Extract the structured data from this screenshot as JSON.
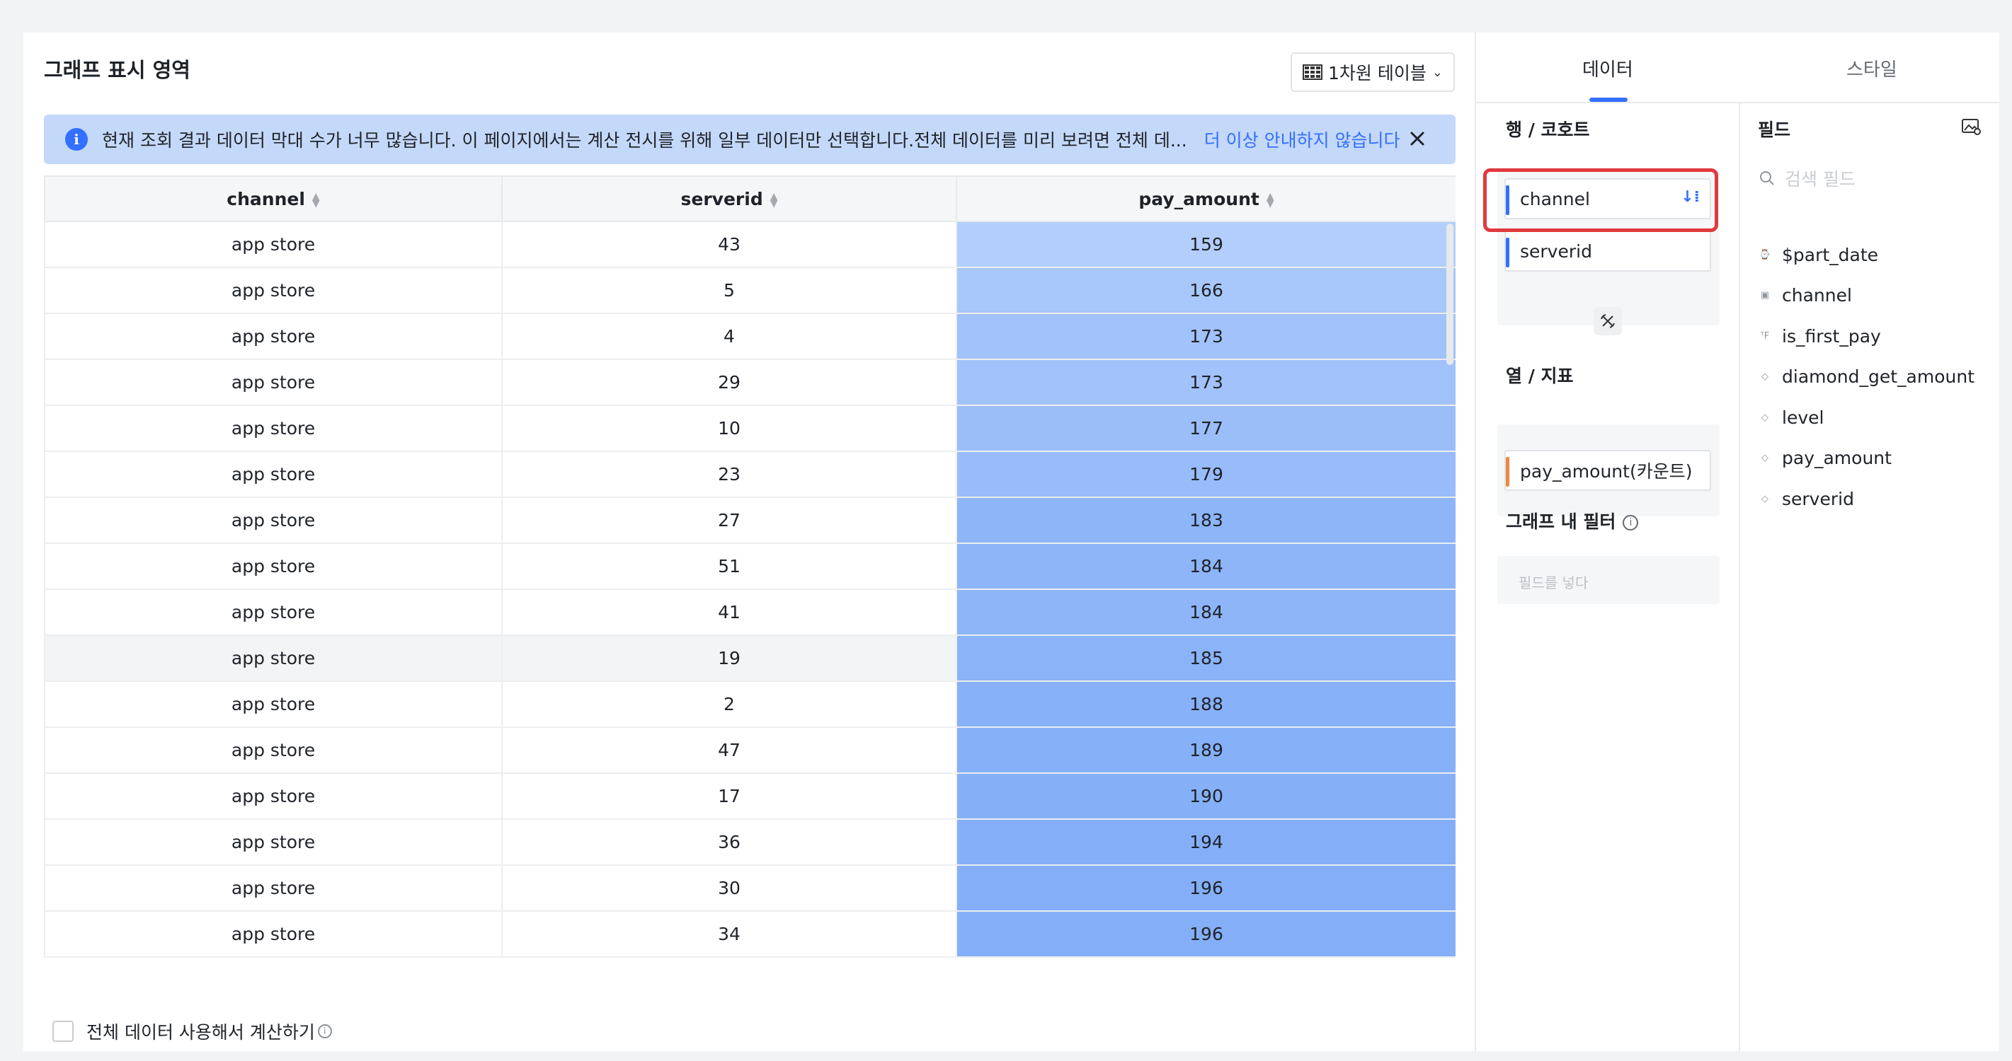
{
  "main": {
    "title": "그래프 표시 영역",
    "chart_type_button": "1차원 테이블",
    "notice": {
      "message": "현재 조회 결과 데이터 막대 수가 너무 많습니다. 이 페이지에서는 계산 전시를 위해 일부 데이터만 선택합니다.전체 데이터를 미리 보려면 전체 데...",
      "dismiss_link": "더 이상 안내하지 않습니다"
    },
    "table": {
      "columns": [
        "channel",
        "serverid",
        "pay_amount"
      ],
      "rows": [
        [
          "app store",
          "43",
          "159"
        ],
        [
          "app store",
          "5",
          "166"
        ],
        [
          "app store",
          "4",
          "173"
        ],
        [
          "app store",
          "29",
          "173"
        ],
        [
          "app store",
          "10",
          "177"
        ],
        [
          "app store",
          "23",
          "179"
        ],
        [
          "app store",
          "27",
          "183"
        ],
        [
          "app store",
          "51",
          "184"
        ],
        [
          "app store",
          "41",
          "184"
        ],
        [
          "app store",
          "19",
          "185"
        ],
        [
          "app store",
          "2",
          "188"
        ],
        [
          "app store",
          "47",
          "189"
        ],
        [
          "app store",
          "17",
          "190"
        ],
        [
          "app store",
          "36",
          "194"
        ],
        [
          "app store",
          "30",
          "196"
        ],
        [
          "app store",
          "34",
          "196"
        ]
      ],
      "heat_colors": [
        "#b3cefb",
        "#a8c7fa",
        "#a1c2fa",
        "#a1c2fa",
        "#9bbef9",
        "#98bcf9",
        "#8db5f8",
        "#8db5f8",
        "#8db5f8",
        "#8ab3f8",
        "#87b1f8",
        "#86b0f8",
        "#85b0f8",
        "#84aff8",
        "#84aff8",
        "#84aff8"
      ]
    },
    "full_calc_label": "전체 데이터 사용해서 계산하기"
  },
  "sidebar": {
    "tabs": [
      "데이터",
      "스타일"
    ],
    "rows_title": "행 / 코호트",
    "rows": [
      "channel",
      "serverid"
    ],
    "columns_title": "열 / 지표",
    "columns": [
      "pay_amount(카운트)"
    ],
    "filter_title": "그래프 내 필터",
    "filter_placeholder": "필드를 넣다",
    "fields_title": "필드",
    "search_placeholder": "검색 필드",
    "fields": [
      "$part_date",
      "channel",
      "is_first_pay",
      "diamond_get_amount",
      "level",
      "pay_amount",
      "serverid"
    ],
    "colors": {
      "row_bar": "#3370ff",
      "col_bar": "#f0883e",
      "highlight": "#e0393e",
      "accent": "#3370ff"
    }
  }
}
